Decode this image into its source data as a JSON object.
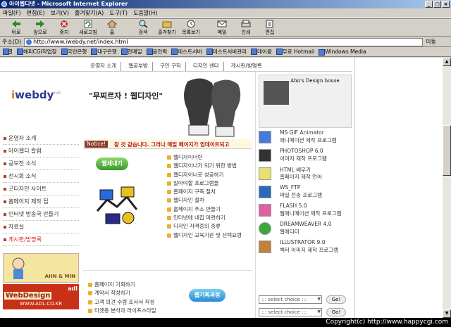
{
  "window": {
    "title": "아이웹디넷 - Microsoft Internet Explorer"
  },
  "menu": [
    "파일(F)",
    "편집(E)",
    "보기(V)",
    "즐겨찾기(A)",
    "도구(T)",
    "도움말(H)"
  ],
  "toolbar": {
    "back": "뒤로",
    "forward": "앞으로",
    "stop": "중지",
    "refresh": "새로고침",
    "home": "홈",
    "search": "검색",
    "favorites": "즐겨찾기",
    "history": "목록보기",
    "mail": "메일",
    "print": "인쇄",
    "edit": "편집"
  },
  "address": {
    "label": "주소(D)",
    "url": "http://www.iwebdy.net/index.html",
    "go": "이동"
  },
  "links": {
    "label": "연결",
    "items": [
      "해피CGI작업장",
      "국민은행",
      "대구은행",
      "한메일",
      "음인력",
      "테스트서버",
      "테스트서버관리",
      "데이콤",
      "무료 Hotmail",
      "Windows Media"
    ]
  },
  "site": {
    "nav": [
      "운영자 소개",
      "웹공부방",
      "구인 구직",
      "디자인 센타",
      "게시판/방명록"
    ],
    "logo": {
      "i": "i",
      "rest": "webdy",
      "net": "net"
    },
    "slogan": "\"무찌르자 ! 웹디자인\"",
    "notice_label": "Notice!",
    "notice_text": "잘 것 같습니다. 그러나 매일 페이지가 업데이트되고",
    "left_menu": [
      "운영자 소개",
      "아이웹디 칼럼",
      "공모전 소식",
      "전시회 소식",
      "굿디자인 사이트",
      "홈페이지 제작 팁",
      "인터넷 방송국 만들기",
      "자료실",
      "게시판/방명록"
    ],
    "banner1": "AHN & MIN",
    "banner2_top": "adl",
    "banner2_mid": "WebDesign",
    "banner2_url": "WWW.ADL.CO.KR",
    "pill1": "웹세내기",
    "pill2": "웹기획과정",
    "list1": [
      "웹디자이너란",
      "웹디자이너가 되기 위한 방법",
      "웹디자이너로 성공하기",
      "알아야할 프로그램들",
      "홈페이지 구축 절차",
      "웹디자인 절차",
      "홈페이지 주소 만들기",
      "인터넷에 내집 마련하기",
      "디자인 자격증의 종류",
      "웹디자인 교육기관 및 선택요령"
    ],
    "list2": [
      "홈페이지 기획하기",
      "계약서 작성하기",
      "고객 의견 수렴 조사서 작성",
      "타겟층 분석과 라이프스타일"
    ],
    "ahn_title": "Ahn's Design",
    "ahn_sub": "house",
    "programs": [
      {
        "name": "MS GIF Animator",
        "desc": "애니메이션 제작 프로그램"
      },
      {
        "name": "PHOTOSHOP 6.0",
        "desc": "이미지 제작 프로그램"
      },
      {
        "name": "HTML 배우기",
        "desc": "홈페이지 제작 언어"
      },
      {
        "name": "WS_FTP",
        "desc": "파일 전송 프로그램"
      },
      {
        "name": "FLASH 5.0",
        "desc": "웹애니메이션 제작 프로그램"
      },
      {
        "name": "DREAMWEAVER 4.0",
        "desc": "웹에디터"
      },
      {
        "name": "ILLUSTRATOR 9.0",
        "desc": "벡터 이미지 제작 프로그램"
      }
    ],
    "select_label": "::: select choice :::",
    "go_label": "Go!"
  },
  "status": "Copyright(c) http://www.happycgi.com"
}
